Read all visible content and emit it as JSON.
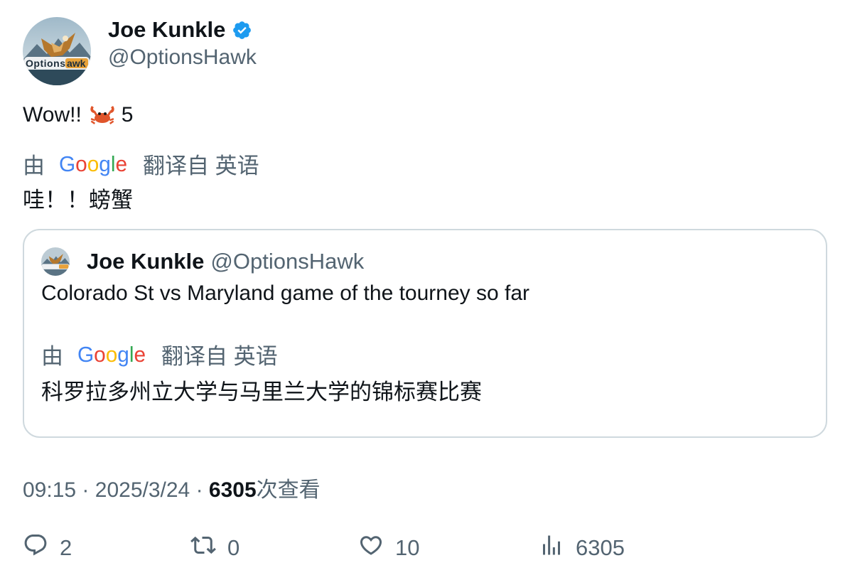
{
  "author": {
    "display_name": "Joe Kunkle",
    "handle": "@OptionsHawk",
    "verified": true,
    "avatar_text": "OptionsHawk"
  },
  "tweet": {
    "text_before": "Wow!!",
    "emoji": "crab",
    "text_after": "5",
    "translation": {
      "by_label": "由",
      "provider": "Google",
      "from_label": "翻译自 英语",
      "text": "哇！！螃蟹"
    }
  },
  "quoted_tweet": {
    "display_name": "Joe Kunkle",
    "handle": "@OptionsHawk",
    "text": "Colorado St vs Maryland game of the tourney so far",
    "translation": {
      "by_label": "由",
      "provider": "Google",
      "from_label": "翻译自 英语",
      "text": "科罗拉多州立大学与马里兰大学的锦标赛比赛"
    }
  },
  "meta": {
    "time": "09:15",
    "separator": "·",
    "date": "2025/3/24",
    "views_count": "6305",
    "views_label": "次查看"
  },
  "actions": {
    "replies": "2",
    "retweets": "0",
    "likes": "10",
    "views": "6305"
  },
  "colors": {
    "text_primary": "#0f1419",
    "text_secondary": "#536471",
    "verified_blue": "#1d9bf0",
    "border": "#cfd9de"
  }
}
